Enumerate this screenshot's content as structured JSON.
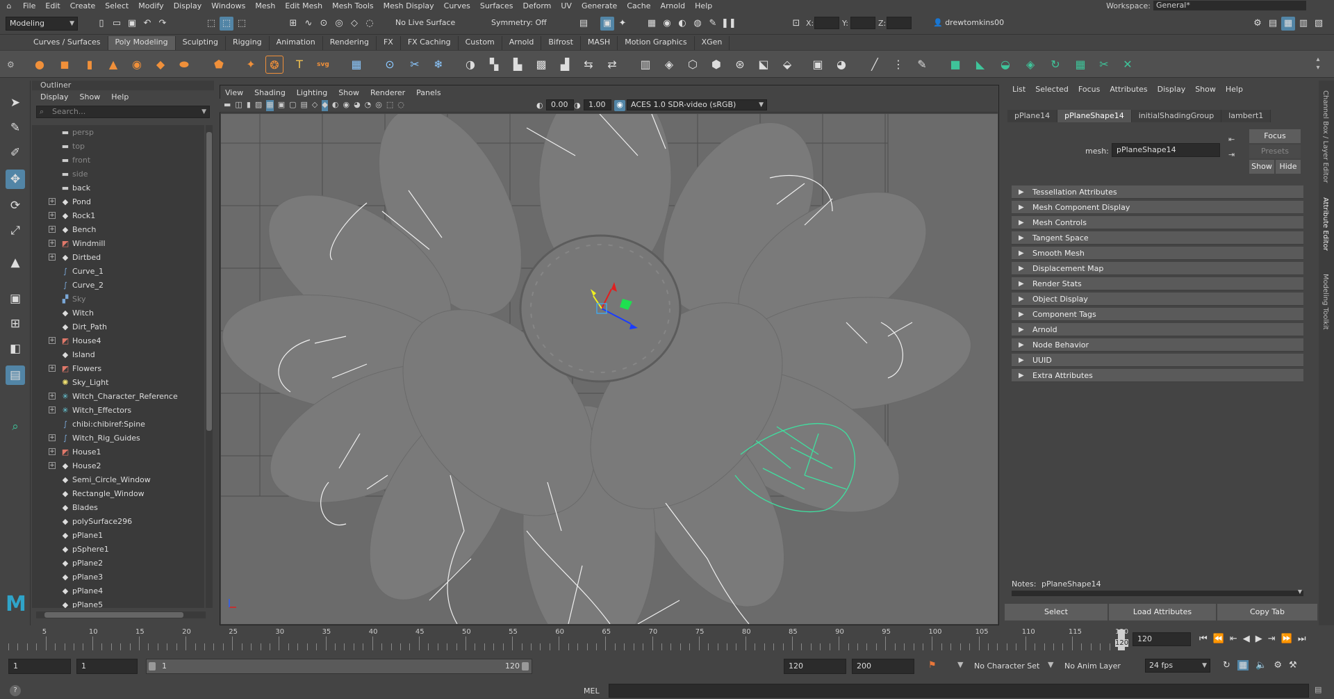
{
  "menubar": {
    "items": [
      "File",
      "Edit",
      "Create",
      "Select",
      "Modify",
      "Display",
      "Windows",
      "Mesh",
      "Edit Mesh",
      "Mesh Tools",
      "Mesh Display",
      "Curves",
      "Surfaces",
      "Deform",
      "UV",
      "Generate",
      "Cache",
      "Arnold",
      "Help"
    ],
    "workspace_label": "Workspace:",
    "workspace_value": "General*"
  },
  "statusline": {
    "menuset": "Modeling",
    "live_surface": "No Live Surface",
    "symmetry": "Symmetry: Off",
    "x_label": "X:",
    "y_label": "Y:",
    "z_label": "Z:",
    "user": "drewtomkins00"
  },
  "shelf": {
    "tabs": [
      "Curves / Surfaces",
      "Poly Modeling",
      "Sculpting",
      "Rigging",
      "Animation",
      "Rendering",
      "FX",
      "FX Caching",
      "Custom",
      "Arnold",
      "Bifrost",
      "MASH",
      "Motion Graphics",
      "XGen"
    ],
    "active_tab": "Poly Modeling",
    "svg_label": "svg",
    "text_tool": "T"
  },
  "outliner": {
    "title": "Outliner",
    "menu": [
      "Display",
      "Show",
      "Help"
    ],
    "search_placeholder": "Search...",
    "items": [
      {
        "label": "persp",
        "icon": "camera",
        "dim": true,
        "exp": false
      },
      {
        "label": "top",
        "icon": "camera",
        "dim": true,
        "exp": false
      },
      {
        "label": "front",
        "icon": "camera",
        "dim": true,
        "exp": false
      },
      {
        "label": "side",
        "icon": "camera",
        "dim": true,
        "exp": false
      },
      {
        "label": "back",
        "icon": "camera",
        "dim": false,
        "exp": false
      },
      {
        "label": "Pond",
        "icon": "group",
        "dim": false,
        "exp": true
      },
      {
        "label": "Rock1",
        "icon": "group",
        "dim": false,
        "exp": true
      },
      {
        "label": "Bench",
        "icon": "group",
        "dim": false,
        "exp": true
      },
      {
        "label": "Windmill",
        "icon": "set",
        "dim": false,
        "exp": true
      },
      {
        "label": "Dirtbed",
        "icon": "group",
        "dim": false,
        "exp": true
      },
      {
        "label": "Curve_1",
        "icon": "curve",
        "dim": false,
        "exp": false
      },
      {
        "label": "Curve_2",
        "icon": "curve",
        "dim": false,
        "exp": false
      },
      {
        "label": "Sky",
        "icon": "sky",
        "dim": true,
        "exp": false
      },
      {
        "label": "Witch",
        "icon": "group",
        "dim": false,
        "exp": false
      },
      {
        "label": "Dirt_Path",
        "icon": "group",
        "dim": false,
        "exp": false
      },
      {
        "label": "House4",
        "icon": "set",
        "dim": false,
        "exp": true
      },
      {
        "label": "Island",
        "icon": "group",
        "dim": false,
        "exp": false
      },
      {
        "label": "Flowers",
        "icon": "set",
        "dim": false,
        "exp": true
      },
      {
        "label": "Sky_Light",
        "icon": "light",
        "dim": false,
        "exp": false
      },
      {
        "label": "Witch_Character_Reference",
        "icon": "joint",
        "dim": false,
        "exp": true
      },
      {
        "label": "Witch_Effectors",
        "icon": "joint",
        "dim": false,
        "exp": true
      },
      {
        "label": "chibi:chibiref:Spine",
        "icon": "curve",
        "dim": false,
        "exp": false
      },
      {
        "label": "Witch_Rig_Guides",
        "icon": "curve",
        "dim": false,
        "exp": true
      },
      {
        "label": "House1",
        "icon": "set",
        "dim": false,
        "exp": true
      },
      {
        "label": "House2",
        "icon": "group",
        "dim": false,
        "exp": true
      },
      {
        "label": "Semi_Circle_Window",
        "icon": "group",
        "dim": false,
        "exp": false
      },
      {
        "label": "Rectangle_Window",
        "icon": "group",
        "dim": false,
        "exp": false
      },
      {
        "label": "Blades",
        "icon": "group",
        "dim": false,
        "exp": false
      },
      {
        "label": "polySurface296",
        "icon": "group",
        "dim": false,
        "exp": false
      },
      {
        "label": "pPlane1",
        "icon": "group",
        "dim": false,
        "exp": false
      },
      {
        "label": "pSphere1",
        "icon": "group",
        "dim": false,
        "exp": false
      },
      {
        "label": "pPlane2",
        "icon": "group",
        "dim": false,
        "exp": false
      },
      {
        "label": "pPlane3",
        "icon": "group",
        "dim": false,
        "exp": false
      },
      {
        "label": "pPlane4",
        "icon": "group",
        "dim": false,
        "exp": false
      },
      {
        "label": "pPlane5",
        "icon": "group",
        "dim": false,
        "exp": false
      }
    ]
  },
  "viewport": {
    "menu": [
      "View",
      "Shading",
      "Lighting",
      "Show",
      "Renderer",
      "Panels"
    ],
    "exposure": "0.00",
    "gamma": "1.00",
    "colorspace": "ACES 1.0 SDR-video (sRGB)"
  },
  "attribute_editor": {
    "menu": [
      "List",
      "Selected",
      "Focus",
      "Attributes",
      "Display",
      "Show",
      "Help"
    ],
    "tabs": [
      "pPlane14",
      "pPlaneShape14",
      "initialShadingGroup",
      "lambert1"
    ],
    "active_tab": "pPlaneShape14",
    "mesh_label": "mesh:",
    "mesh_value": "pPlaneShape14",
    "focus_button": "Focus",
    "presets_button": "Presets",
    "show_button": "Show",
    "hide_button": "Hide",
    "sections": [
      "Tessellation Attributes",
      "Mesh Component Display",
      "Mesh Controls",
      "Tangent Space",
      "Smooth Mesh",
      "Displacement Map",
      "Render Stats",
      "Object Display",
      "Component Tags",
      "Arnold",
      "Node Behavior",
      "UUID",
      "Extra Attributes"
    ],
    "notes_label": "Notes:",
    "notes_value": "pPlaneShape14",
    "select_button": "Select",
    "load_button": "Load Attributes",
    "copy_button": "Copy Tab"
  },
  "side_tabs": [
    "Channel Box / Layer Editor",
    "Attribute Editor",
    "Modeling Toolkit"
  ],
  "timeline": {
    "ticks": [
      "5",
      "10",
      "15",
      "20",
      "25",
      "30",
      "35",
      "40",
      "45",
      "50",
      "55",
      "60",
      "65",
      "70",
      "75",
      "80",
      "85",
      "90",
      "95",
      "100",
      "105",
      "110",
      "115",
      "120"
    ],
    "current_frame": "120",
    "current_field": "120"
  },
  "range": {
    "start": "1",
    "start2": "1",
    "slider_start": "1",
    "slider_end": "120",
    "end": "120",
    "end2": "200",
    "character_set": "No Character Set",
    "anim_layer": "No Anim Layer",
    "fps": "24 fps"
  },
  "cmdline": {
    "lang": "MEL",
    "help": "?"
  },
  "colors": {
    "accent": "#5285a6",
    "selection_green": "#3fe0a0"
  }
}
